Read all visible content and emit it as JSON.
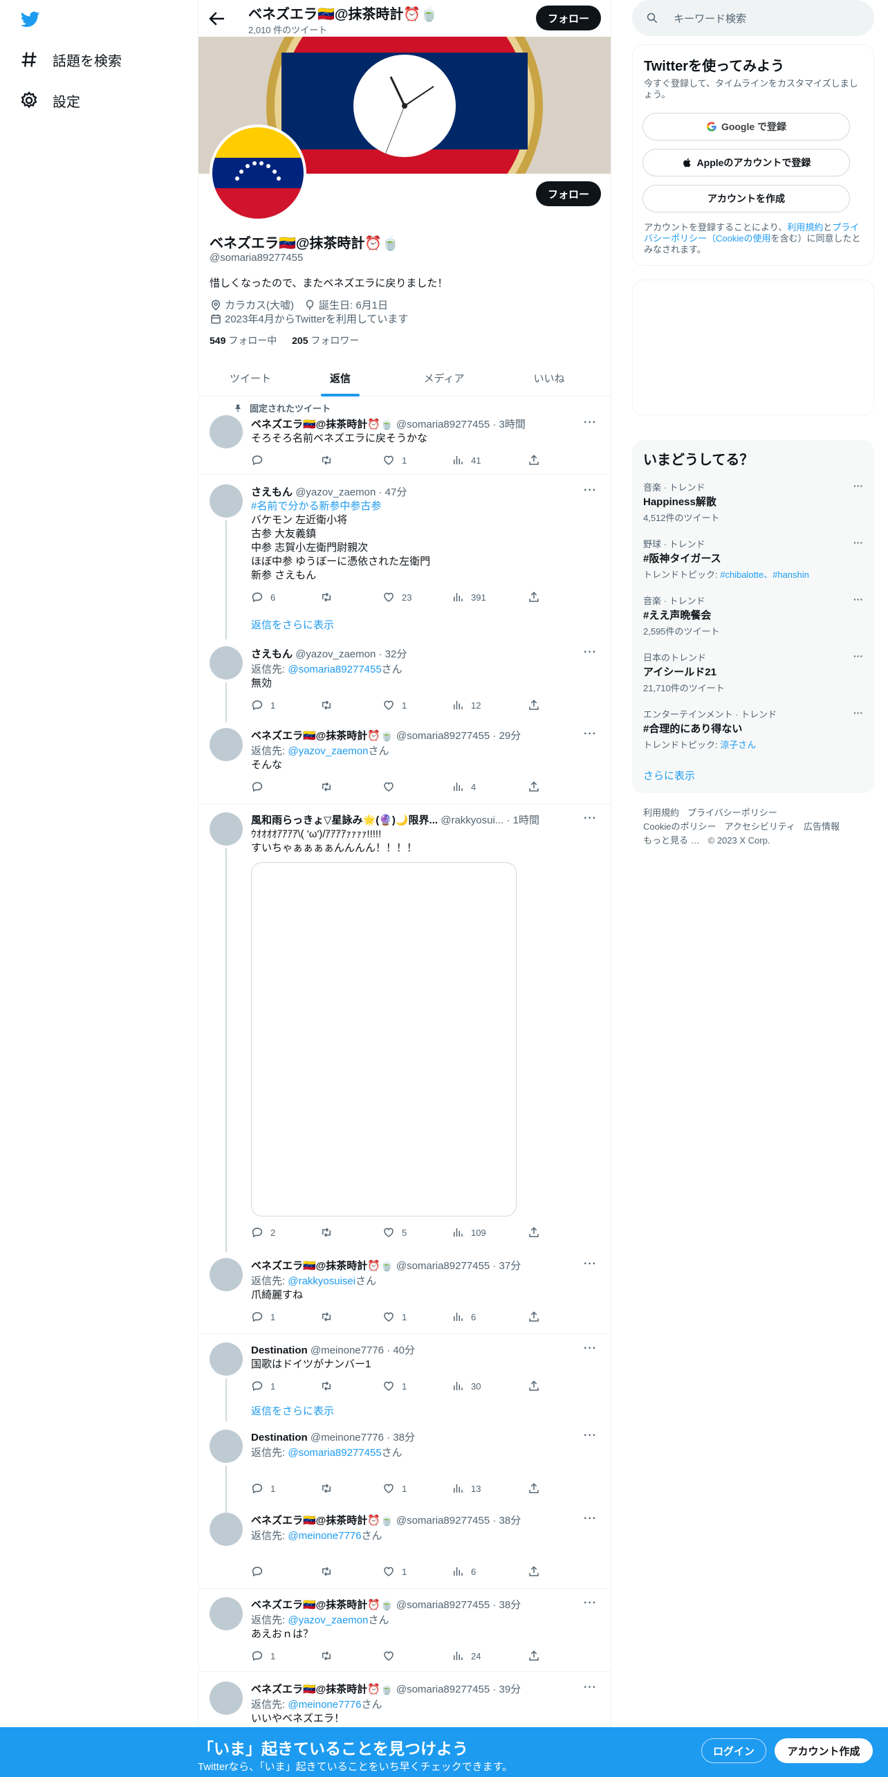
{
  "nav": {
    "explore": "話題を検索",
    "settings": "設定"
  },
  "header": {
    "title": "ベネズエラ🇻🇪@抹茶時計⏰🍵",
    "tweets_count": "2,010 件のツイート",
    "follow": "フォロー"
  },
  "profile": {
    "name": "ベネズエラ🇻🇪@抹茶時計⏰🍵",
    "handle": "@somaria89277455",
    "bio": "惜しくなったので、またベネズエラに戻りました！",
    "location": "カラカス(大嘘)",
    "birthday": "誕生日: 6月1日",
    "joined": "2023年4月からTwitterを利用しています",
    "following_count": "549",
    "following_label": "フォロー中",
    "followers_count": "205",
    "followers_label": "フォロワー",
    "follow": "フォロー"
  },
  "tabs": [
    "ツイート",
    "返信",
    "メディア",
    "いいね"
  ],
  "pinned_label": "固定されたツイート",
  "show_more_replies": "返信をさらに表示",
  "reply_to_prefix": "返信先: ",
  "reply_to_suffix": "さん",
  "tweets": [
    {
      "name": "ベネズエラ🇻🇪@抹茶時計⏰🍵",
      "meta": "@somaria89277455 · 3時間",
      "text": "そろそろ名前ベネズエラに戻そうかな",
      "reply": "",
      "retweet": "",
      "like": "1",
      "views": "41"
    },
    {
      "name": "さえもん",
      "meta": "@yazov_zaemon · 47分",
      "hashtag": "#名前で分かる新参中参古参",
      "text": "バケモン 左近衛小将\n古参 大友義鎮\n中参 志賀小左衛門尉親次\nほぼ中参 ゆうぼーに憑依された左衛門\n新参 さえもん",
      "reply": "6",
      "retweet": "",
      "like": "23",
      "views": "391"
    },
    {
      "name": "さえもん",
      "meta": "@yazov_zaemon · 32分",
      "reply_to": "@somaria89277455",
      "text": "無効",
      "reply": "1",
      "retweet": "",
      "like": "1",
      "views": "12"
    },
    {
      "name": "ベネズエラ🇻🇪@抹茶時計⏰🍵",
      "meta": "@somaria89277455 · 29分",
      "reply_to": "@yazov_zaemon",
      "text": "そんな",
      "reply": "",
      "retweet": "",
      "like": "",
      "views": "4"
    },
    {
      "name": "風和雨らっきょ▽星詠み🌟(🔮)🌙限界...",
      "meta": "@rakkyosui... · 1時間",
      "text": "ｳｵｵｵｵｱｱｱｱ\\( 'ω')/ｱｱｱｱｧｧｧｧ!!!!!\nすいちゃぁぁぁぁんんんん！！！！",
      "reply": "2",
      "retweet": "",
      "like": "5",
      "views": "109"
    },
    {
      "name": "ベネズエラ🇻🇪@抹茶時計⏰🍵",
      "meta": "@somaria89277455 · 37分",
      "reply_to": "@rakkyosuisei",
      "text": "爪綺麗すね",
      "reply": "1",
      "retweet": "",
      "like": "1",
      "views": "6"
    },
    {
      "name": "Destination",
      "meta": "@meinone7776 · 40分",
      "text": "国歌はドイツがナンバー1",
      "reply": "1",
      "retweet": "",
      "like": "1",
      "views": "30"
    },
    {
      "name": "Destination",
      "meta": "@meinone7776 · 38分",
      "reply_to": "@somaria89277455",
      "text": "",
      "reply": "1",
      "retweet": "",
      "like": "1",
      "views": "13"
    },
    {
      "name": "ベネズエラ🇻🇪@抹茶時計⏰🍵",
      "meta": "@somaria89277455 · 38分",
      "reply_to": "@meinone7776",
      "text": "",
      "reply": "",
      "retweet": "",
      "like": "1",
      "views": "6"
    },
    {
      "name": "ベネズエラ🇻🇪@抹茶時計⏰🍵",
      "meta": "@somaria89277455 · 38分",
      "reply_to": "@yazov_zaemon",
      "text": "あえおｎは？",
      "reply": "1",
      "retweet": "",
      "like": "",
      "views": "24"
    },
    {
      "name": "ベネズエラ🇻🇪@抹茶時計⏰🍵",
      "meta": "@somaria89277455 · 39分",
      "reply_to": "@meinone7776",
      "text": "いいやベネズエラ！",
      "reply": "",
      "retweet": "",
      "like": "",
      "views": ""
    }
  ],
  "sidebar": {
    "search_placeholder": "キーワード検索",
    "signup": {
      "title": "Twitterを使ってみよう",
      "subtitle": "今すぐ登録して、タイムラインをカスタマイズしましょう。",
      "google": "Google で登録",
      "apple": "Appleのアカウントで登録",
      "create": "アカウントを作成",
      "legal_pre": "アカウントを登録することにより、",
      "legal_terms": "利用規約",
      "legal_and": "と",
      "legal_privacy": "プライバシーポリシー（Cookieの使用",
      "legal_post": "を含む）に同意したとみなされます。"
    },
    "trends_title": "いまどうしてる？",
    "trends": [
      {
        "meta": "音楽 · トレンド",
        "name": "Happiness解散",
        "sub": "4,512件のツイート"
      },
      {
        "meta": "野球 · トレンド",
        "name": "#阪神タイガース",
        "sub_prefix": "トレンドトピック: ",
        "sub_links": "#chibalotte、#hanshin"
      },
      {
        "meta": "音楽 · トレンド",
        "name": "#ええ声晩餐会",
        "sub": "2,595件のツイート"
      },
      {
        "meta": "日本のトレンド",
        "name": "アイシールド21",
        "sub": "21,710件のツイート"
      },
      {
        "meta": "エンターテインメント · トレンド",
        "name": "#合理的にあり得ない",
        "sub_prefix": "トレンドトピック: ",
        "sub_links": "涼子さん"
      }
    ],
    "show_more": "さらに表示",
    "footer": [
      "利用規約",
      "プライバシーポリシー",
      "Cookieのポリシー",
      "アクセシビリティ",
      "広告情報",
      "もっと見る …",
      "© 2023 X Corp."
    ]
  },
  "bottom": {
    "title": "「いま」起きていることを見つけよう",
    "subtitle": "Twitterなら、「いま」起きていることをいち早くチェックできます。",
    "login": "ログイン",
    "signup": "アカウント作成"
  },
  "colors": {
    "accent": "#1d9bf0",
    "text": "#0f1419",
    "muted": "#536471",
    "border": "#eff3f4"
  }
}
